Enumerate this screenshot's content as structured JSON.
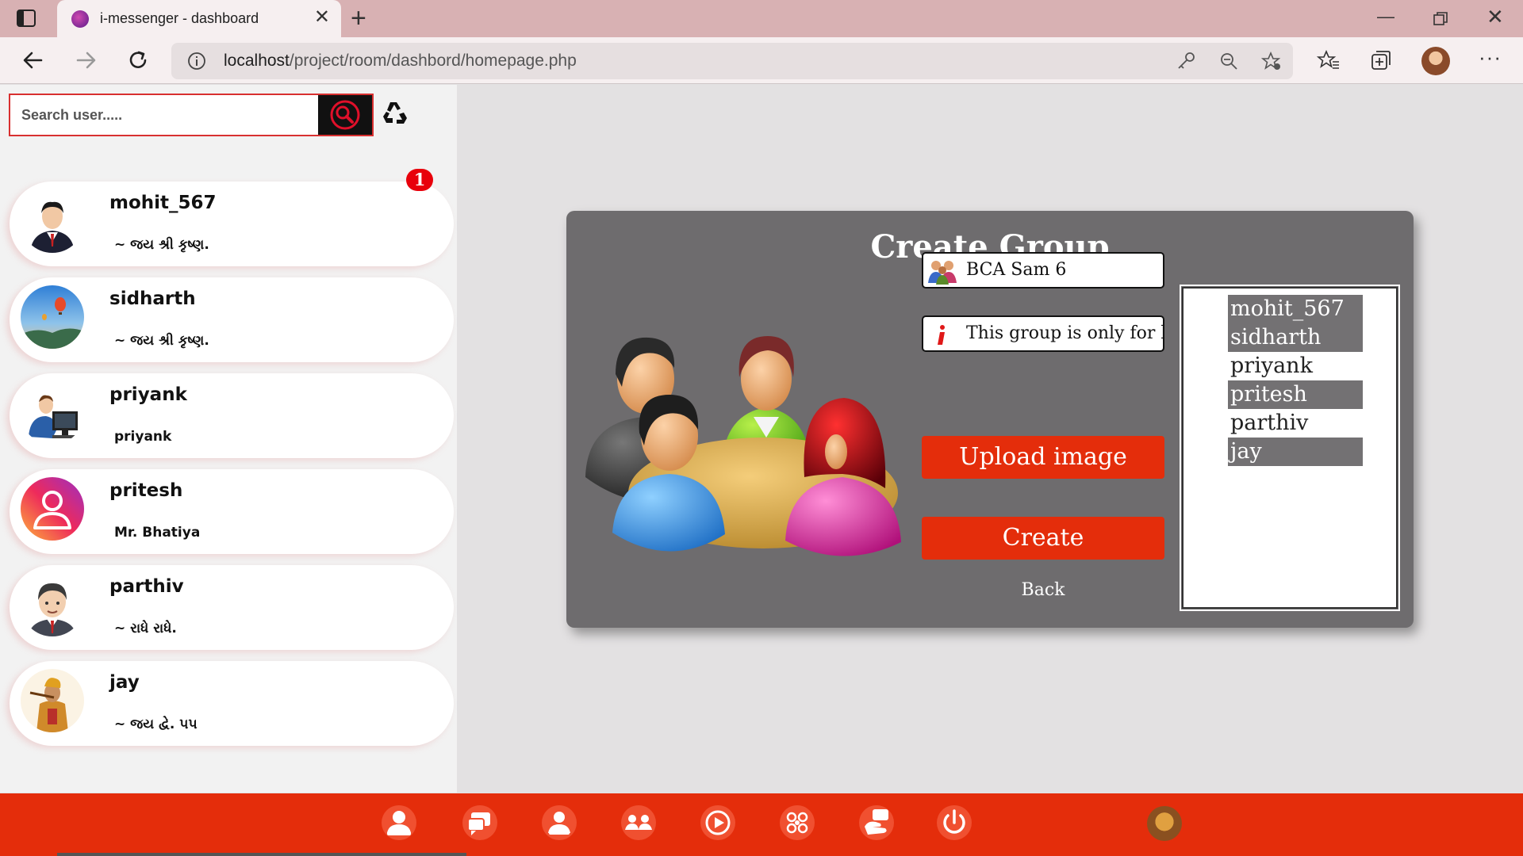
{
  "browser": {
    "tab_title": "i-messenger - dashboard",
    "url_host": "localhost",
    "url_path": "/project/room/dashbord/homepage.php"
  },
  "sidebar": {
    "search_placeholder": "Search user.....",
    "users": [
      {
        "name": "mohit_567",
        "status": "~ જય શ્રી કૃષ્ણ.",
        "unread": "1"
      },
      {
        "name": "sidharth",
        "status": "~ જય શ્રી કૃષ્ણ."
      },
      {
        "name": "priyank",
        "status": "priyank"
      },
      {
        "name": "pritesh",
        "status": "Mr. Bhatiya"
      },
      {
        "name": "parthiv",
        "status": "~ રાધે રાધે."
      },
      {
        "name": "jay",
        "status": "~ જય દ્વે. ૫૫"
      }
    ]
  },
  "create_group": {
    "title": "Create Group",
    "group_name_value": "BCA Sam 6",
    "description_value": "This group is only for bca",
    "upload_label": "Upload image",
    "create_label": "Create",
    "back_label": "Back",
    "members": [
      {
        "name": "mohit_567",
        "selected": true
      },
      {
        "name": "sidharth",
        "selected": true
      },
      {
        "name": "priyank",
        "selected": false
      },
      {
        "name": "pritesh",
        "selected": true
      },
      {
        "name": "parthiv",
        "selected": false
      },
      {
        "name": "jay",
        "selected": true
      }
    ]
  },
  "colors": {
    "accent_red": "#e42d0b",
    "panel_gray": "#6e6c6e",
    "badge_red": "#e8000b"
  },
  "bottom_nav_icons": [
    "profile-icon",
    "chats-icon",
    "add-user-icon",
    "groups-icon",
    "video-icon",
    "apps-icon",
    "feedback-icon",
    "power-icon"
  ]
}
